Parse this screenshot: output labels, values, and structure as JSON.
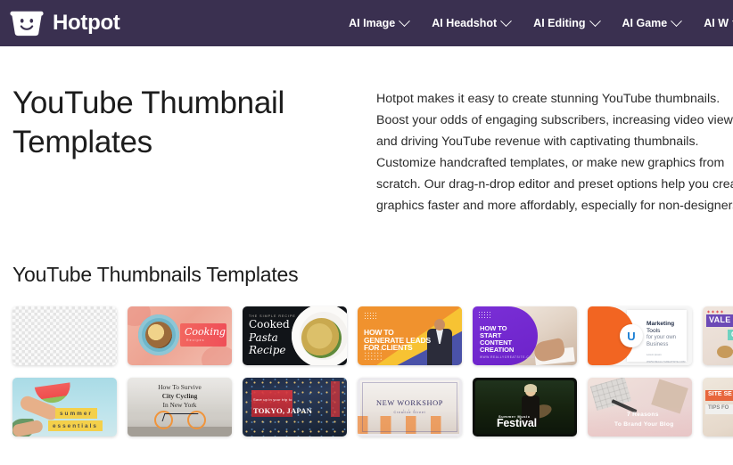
{
  "header": {
    "brand_name": "Hotpot",
    "logo_icon": "hotpot-smiley-pot-icon",
    "background_color": "#3a3050",
    "nav_items": [
      {
        "label": "AI Image",
        "caret_icon": "chevron-down-icon"
      },
      {
        "label": "AI Headshot",
        "caret_icon": "chevron-down-icon"
      },
      {
        "label": "AI Editing",
        "caret_icon": "chevron-down-icon"
      },
      {
        "label": "AI Game",
        "caret_icon": "chevron-down-icon"
      },
      {
        "label": "AI W",
        "caret_icon": "chevron-down-icon"
      }
    ]
  },
  "hero": {
    "title": "YouTube Thumbnail Templates",
    "description": "Hotpot makes it easy to create stunning YouTube thumbnails. Boost your odds of engaging subscribers, increasing video views, and driving YouTube revenue with captivating thumbnails. Customize handcrafted templates, or make new graphics from scratch. Our drag-n-drop editor and preset options help you create graphics faster and more affordably, especially for non-designers."
  },
  "section": {
    "title": "YouTube Thumbnails Templates"
  },
  "templates": [
    {
      "name": "blank-transparent-template",
      "style": "t-blank",
      "title": "",
      "lines": []
    },
    {
      "name": "cooking-recipe-template",
      "style": "t-cooking",
      "title": "Cooking",
      "subtitle": "Recipes"
    },
    {
      "name": "cooked-pasta-recipe-template",
      "style": "t-pasta",
      "kicker": "The Simple Recipe",
      "line1": "Cooked",
      "line2": "Pasta",
      "line3": "Recipe"
    },
    {
      "name": "generate-leads-template",
      "style": "t-leads",
      "line1": "HOW TO",
      "line2": "GENERATE LEADS",
      "line3": "FOR CLIENTS"
    },
    {
      "name": "content-creation-template",
      "style": "t-content",
      "line1": "HOW TO",
      "line2": "START",
      "line3": "CONTENT",
      "line4": "CREATION",
      "subtitle": "WWW.REALLYGREATSITE.COM"
    },
    {
      "name": "marketing-tools-template",
      "style": "t-mkt",
      "badge_letter": "U",
      "title_bold": "Marketing",
      "title_rest": " Tools",
      "line2": "for your own",
      "line3": "Business",
      "small1": "Lorem ipsum",
      "small2": "WWW.REALLYGREATSITE.COM"
    },
    {
      "name": "valentine-gift-template",
      "style": "t-val",
      "line1": "VALE",
      "line2": "GI"
    },
    {
      "name": "summer-essentials-template",
      "style": "t-summer",
      "tag1": "summer",
      "tag2": "essentials"
    },
    {
      "name": "city-cycling-new-york-template",
      "style": "t-cycle",
      "line1": "How To Survive",
      "line2": "City Cycling",
      "line3": "In New York"
    },
    {
      "name": "tokyo-japan-travel-template",
      "style": "t-tokyo",
      "kicker": "Save up in your trip to",
      "headline": "TOKYO, JAPAN"
    },
    {
      "name": "new-workshop-template",
      "style": "t-work",
      "title": "NEW WORKSHOP",
      "divider": "• • •",
      "subtitle": "Creative Street"
    },
    {
      "name": "summer-music-festival-template",
      "style": "t-fest",
      "kicker": "Summer Music",
      "headline": "Festival"
    },
    {
      "name": "brand-your-blog-template",
      "style": "t-blog",
      "line1": "7 Reasons",
      "line2": "To Brand Your Blog"
    },
    {
      "name": "partial-right-template",
      "style": "t-part",
      "line1": "SITE SE",
      "line2": "TIPS FO"
    }
  ]
}
